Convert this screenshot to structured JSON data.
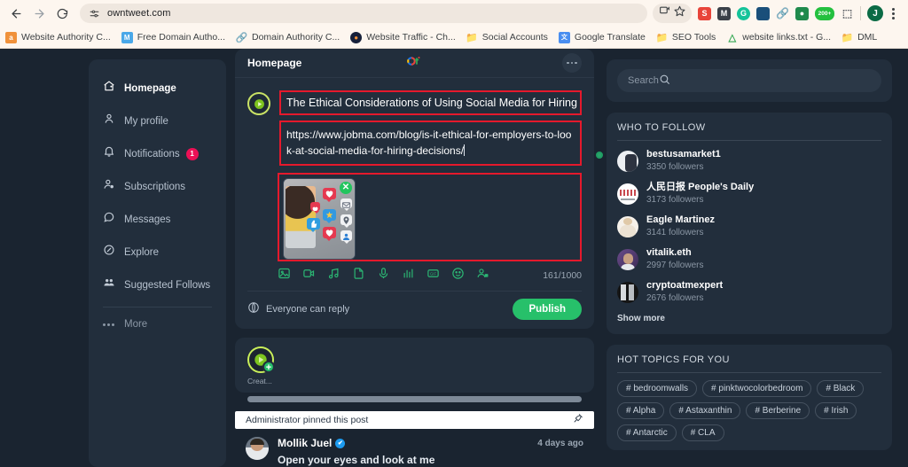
{
  "browser": {
    "url": "owntweet.com",
    "nav": {
      "back": "back-arrow",
      "forward": "forward-arrow",
      "reload": "reload"
    },
    "bookmarks": [
      {
        "label": "Website Authority C...",
        "icon_color": "#f0913a",
        "letter": "a"
      },
      {
        "label": "Free Domain Autho...",
        "icon_color": "#4aa8e8",
        "letter": "M"
      },
      {
        "label": "Domain Authority C...",
        "icon_color": "#4a7fe8",
        "letter": "⚭"
      },
      {
        "label": "Website Traffic - Ch...",
        "icon_color": "#17203a",
        "letter": "◕"
      },
      {
        "label": "Social Accounts",
        "icon_color": "#5f6a75",
        "letter": "🗀"
      },
      {
        "label": "Google Translate",
        "icon_color": "#4a8ef0",
        "letter": "文"
      },
      {
        "label": "SEO Tools",
        "icon_color": "#5f6a75",
        "letter": "🗀"
      },
      {
        "label": "website links.txt - G...",
        "icon_color": "#34a853",
        "letter": "△"
      },
      {
        "label": "DML",
        "icon_color": "#5f6a75",
        "letter": "🗀"
      }
    ],
    "extensions": [
      {
        "name": "semrush-extension",
        "color": "#e8443a",
        "letter": "S"
      },
      {
        "name": "mail-extension",
        "color": "#3a4048",
        "letter": "M"
      },
      {
        "name": "grammarly-extension",
        "color": "#15c39a",
        "letter": "G"
      },
      {
        "name": "wallet-extension",
        "color": "#1a4f7a",
        "letter": "▬"
      },
      {
        "name": "link-extension",
        "color": "#7a9ad0",
        "letter": "🔗"
      },
      {
        "name": "lock-extension",
        "color": "#1f8a4c",
        "letter": "🔒"
      },
      {
        "name": "counter-extension",
        "color": "#24c03f",
        "letter": "200+"
      },
      {
        "name": "puzzle-extension",
        "color": "#6b7280",
        "letter": "⬚"
      }
    ],
    "profile_initial": "J"
  },
  "sidebar": {
    "items": [
      {
        "label": "Homepage",
        "icon": "home-icon",
        "active": true,
        "badge": ""
      },
      {
        "label": "My profile",
        "icon": "person-icon",
        "active": false,
        "badge": ""
      },
      {
        "label": "Notifications",
        "icon": "bell-icon",
        "active": false,
        "badge": "1"
      },
      {
        "label": "Subscriptions",
        "icon": "person-add-icon",
        "active": false,
        "badge": ""
      },
      {
        "label": "Messages",
        "icon": "chat-icon",
        "active": false,
        "badge": ""
      },
      {
        "label": "Explore",
        "icon": "compass-icon",
        "active": false,
        "badge": ""
      },
      {
        "label": "Suggested Follows",
        "icon": "people-icon",
        "active": false,
        "badge": ""
      }
    ],
    "more_label": "More"
  },
  "composer": {
    "header_title": "Homepage",
    "logo_text": "ot",
    "post_title": "The Ethical Considerations of Using Social Media for Hiring",
    "post_url": "https://www.jobma.com/blog/is-it-ethical-for-employers-to-look-at-social-media-for-hiring-decisions/",
    "attachment_alt": "woman holding tablet with social media reaction icons",
    "remove_attachment": "✕",
    "toolbar_icons": [
      "image-icon",
      "video-icon",
      "audio-icon",
      "file-icon",
      "mic-icon",
      "poll-icon",
      "gif-icon",
      "emoji-icon",
      "tag-people-icon"
    ],
    "char_counter": "161/1000",
    "reply_setting": "Everyone can reply",
    "publish_label": "Publish"
  },
  "stories": {
    "create_label": "Creat...",
    "create_plus": "+"
  },
  "pinned": {
    "notice": "Administrator pinned this post",
    "pin_icon": "pin-icon",
    "author": "Mollik Juel",
    "verified": "✔",
    "time": "4 days ago",
    "text": "Open your eyes and look at me"
  },
  "search": {
    "placeholder": "Search",
    "icon": "search-icon"
  },
  "who_to_follow": {
    "title": "WHO TO FOLLOW",
    "show_more": "Show more",
    "users": [
      {
        "name": "bestusamarket1",
        "followers": "3350 followers",
        "av1": "#f2f2f2",
        "av2": "#2d3340"
      },
      {
        "name": "人民日报 People's Daily",
        "followers": "3173 followers",
        "av1": "#ffffff",
        "av2": "#c8484e"
      },
      {
        "name": "Eagle Martinez",
        "followers": "3141 followers",
        "av1": "#f6f1ea",
        "av2": "#e4d7c5"
      },
      {
        "name": "vitalik.eth",
        "followers": "2997 followers",
        "av1": "#6a4b8a",
        "av2": "#c09a77"
      },
      {
        "name": "cryptoatmexpert",
        "followers": "2676 followers",
        "av1": "#171717",
        "av2": "#dcdcdc"
      }
    ]
  },
  "hot_topics": {
    "title": "HOT TOPICS FOR YOU",
    "tags": [
      "bedroomwalls",
      "pinktwocolorbedroom",
      "Black",
      "Alpha",
      "Astaxanthin",
      "Berberine",
      "Irish",
      "Antarctic",
      "CLA"
    ],
    "hash": "#"
  },
  "colors": {
    "page_bg": "#1a2430",
    "panel_bg": "#222e3c",
    "accent_green": "#27c06a",
    "badge_red": "#ec1056",
    "highlight_red": "#e5192c"
  }
}
